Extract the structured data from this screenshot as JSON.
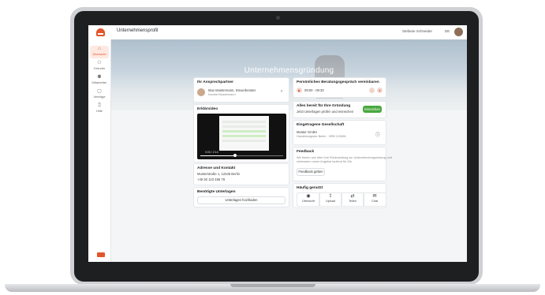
{
  "app": {
    "breadcrumb": "Unternehmensprofil",
    "user_name": "Stefanie Schneider",
    "language": "DE"
  },
  "sidebar": {
    "items": [
      {
        "icon": "home-icon",
        "glyph": "⌂",
        "label": "Übersicht"
      },
      {
        "icon": "users-icon",
        "glyph": "⚇",
        "label": "Gründer"
      },
      {
        "icon": "group-icon",
        "glyph": "⚉",
        "label": "Mitarbeiter"
      },
      {
        "icon": "document-icon",
        "glyph": "▢",
        "label": "Verträge"
      },
      {
        "icon": "help-icon",
        "glyph": "⍰",
        "label": "Hilfe"
      }
    ]
  },
  "hero": {
    "title": "Unternehmensgründung"
  },
  "left": {
    "contact": {
      "title": "Ihr Ansprechpartner",
      "name": "Max Mustermann, Steuerberater",
      "role": "Kanzlei Mustermann"
    },
    "video": {
      "title": "Erklärvideo",
      "time": "0:00 / 2:14"
    },
    "address": {
      "title": "Adresse und Kontakt",
      "line1": "Musterstraße 1, 12345 Berlin",
      "line2": "+49 30 123 456 78"
    },
    "documents": {
      "title": "Benötigte Unterlagen",
      "button": "Unterlagen hochladen"
    }
  },
  "right": {
    "call": {
      "title": "Persönliches Beratungsgespräch vereinbaren",
      "time": "09:00 - 09:30"
    },
    "status": {
      "title": "Alles bereit für Ihre Gründung",
      "subtitle": "Jetzt Unterlagen prüfen und einreichen",
      "button": "Einreichen"
    },
    "company": {
      "title": "Eingetragene Gesellschaft",
      "name": "Muster GmbH",
      "detail": "Handelsregister Berlin · HRB 123456"
    },
    "feedback": {
      "title": "Feedback",
      "body1": "Wir freuen uns über Ihre Rückmeldung zur Unternehmensgründung und",
      "body2": "verbessern unser Angebot laufend für Sie.",
      "button": "Feedback geben"
    },
    "tools": {
      "title": "Häufig genutzt",
      "items": [
        {
          "icon": "dashboard-icon",
          "glyph": "◉",
          "label": "Übersicht"
        },
        {
          "icon": "upload-icon",
          "glyph": "⇪",
          "label": "Upload"
        },
        {
          "icon": "share-icon",
          "glyph": "⇄",
          "label": "Teilen"
        },
        {
          "icon": "chat-icon",
          "glyph": "✉",
          "label": "Chat"
        }
      ]
    }
  }
}
